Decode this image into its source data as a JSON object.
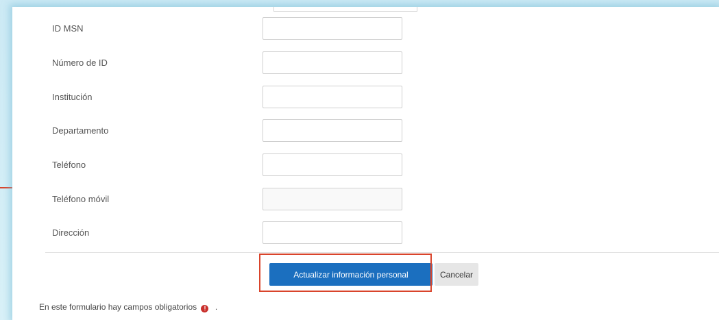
{
  "form": {
    "fields": [
      {
        "label": "ID MSN",
        "value": ""
      },
      {
        "label": "Número de ID",
        "value": ""
      },
      {
        "label": "Institución",
        "value": ""
      },
      {
        "label": "Departamento",
        "value": ""
      },
      {
        "label": "Teléfono",
        "value": ""
      },
      {
        "label": "Teléfono móvil",
        "value": ""
      },
      {
        "label": "Dirección",
        "value": ""
      }
    ],
    "submit_label": "Actualizar información personal",
    "cancel_label": "Cancelar",
    "required_note": "En este formulario hay campos obligatorios",
    "required_icon": "exclamation-icon",
    "required_suffix": "."
  },
  "colors": {
    "primary_button": "#1b6fbf",
    "highlight": "#d9442b",
    "required_icon": "#c9302c"
  }
}
